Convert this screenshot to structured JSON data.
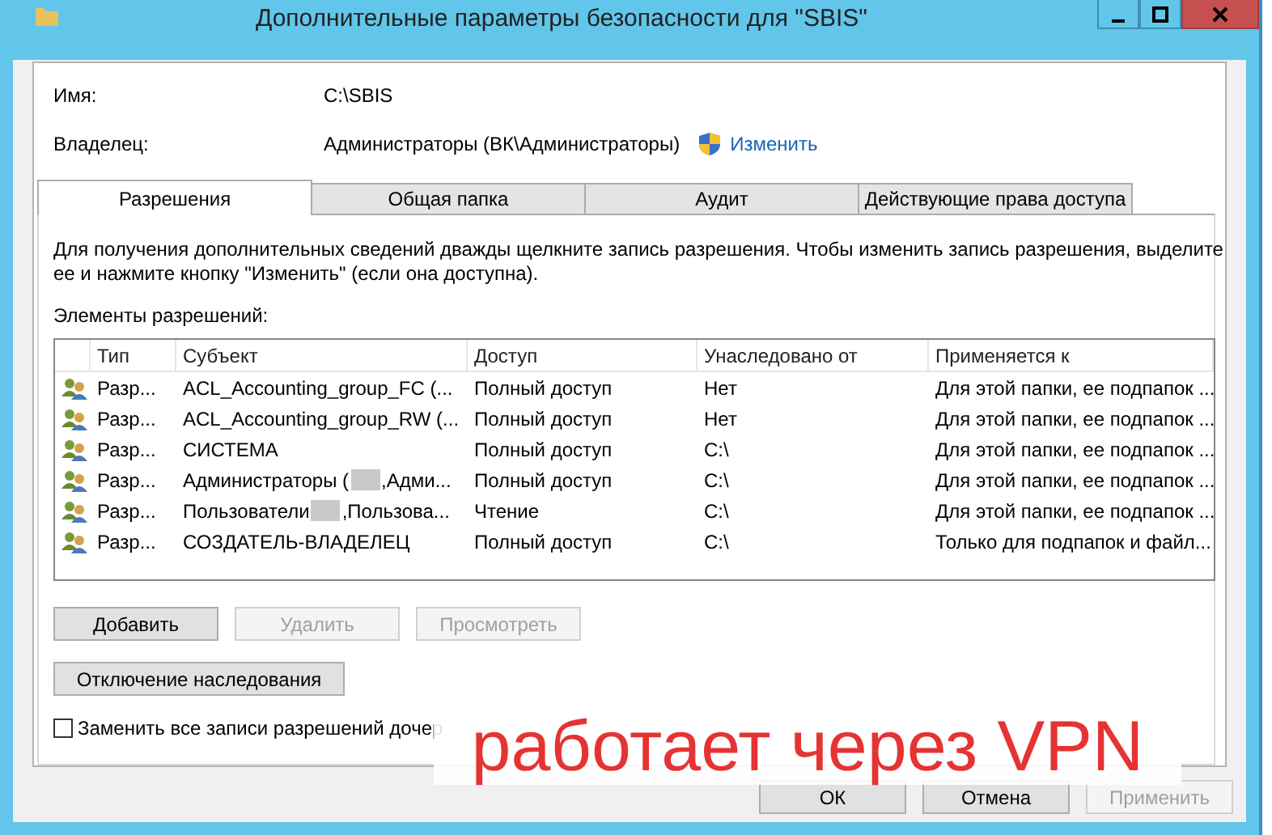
{
  "window": {
    "title": "Дополнительные параметры безопасности  для \"SBIS\""
  },
  "fields": [
    {
      "label": "Имя:",
      "value": "C:\\SBIS"
    },
    {
      "label": "Владелец:",
      "value": "Администраторы (ВК\\Администраторы)",
      "link": "Изменить"
    }
  ],
  "tabs": [
    {
      "label": "Разрешения",
      "selected": true
    },
    {
      "label": "Общая папка",
      "selected": false
    },
    {
      "label": "Аудит",
      "selected": false
    },
    {
      "label": "Действующие права доступа",
      "selected": false
    }
  ],
  "info": "Для получения дополнительных сведений дважды щелкните запись разрешения. Чтобы изменить запись разрешения, выделите ее и нажмите кнопку \"Изменить\" (если она доступна).",
  "list_label": "Элементы разрешений:",
  "table": {
    "columns": [
      "Тип",
      "Субъект",
      "Доступ",
      "Унаследовано от",
      "Применяется к"
    ],
    "rows": [
      {
        "type": "Разр...",
        "subject": "ACL_Accounting_group_FC (...",
        "redacted": false,
        "access": "Полный доступ",
        "inherited": "Нет",
        "applies": "Для этой папки, ее подпапок ..."
      },
      {
        "type": "Разр...",
        "subject": "ACL_Accounting_group_RW (...",
        "redacted": false,
        "access": "Полный доступ",
        "inherited": "Нет",
        "applies": "Для этой папки, ее подпапок ..."
      },
      {
        "type": "Разр...",
        "subject": "СИСТЕМА",
        "redacted": false,
        "access": "Полный доступ",
        "inherited": "C:\\",
        "applies": "Для этой папки, ее подпапок ..."
      },
      {
        "type": "Разр...",
        "subject": "Администраторы (",
        "redacted": true,
        "subject_after": ",Адми...",
        "access": "Полный доступ",
        "inherited": "C:\\",
        "applies": "Для этой папки, ее подпапок ..."
      },
      {
        "type": "Разр...",
        "subject": "Пользователи",
        "redacted": true,
        "subject_after": ",Пользова...",
        "access": "Чтение",
        "inherited": "C:\\",
        "applies": "Для этой папки, ее подпапок ..."
      },
      {
        "type": "Разр...",
        "subject": "СОЗДАТЕЛЬ-ВЛАДЕЛЕЦ",
        "redacted": false,
        "access": "Полный доступ",
        "inherited": "C:\\",
        "applies": "Только для подпапок и файл..."
      }
    ]
  },
  "row_buttons": [
    {
      "label": "Добавить",
      "disabled": false
    },
    {
      "label": "Удалить",
      "disabled": true
    },
    {
      "label": "Просмотреть",
      "disabled": true
    }
  ],
  "inheritance_button": {
    "label": "Отключение наследования",
    "disabled": false
  },
  "replace_checkbox": {
    "label": "Заменить все записи разрешений дочер",
    "checked": false
  },
  "annotation": {
    "text": "работает через VPN"
  },
  "dialog_buttons": [
    {
      "label": "ОК",
      "disabled": false
    },
    {
      "label": "Отмена",
      "disabled": false
    },
    {
      "label": "Применить",
      "disabled": true
    }
  ]
}
